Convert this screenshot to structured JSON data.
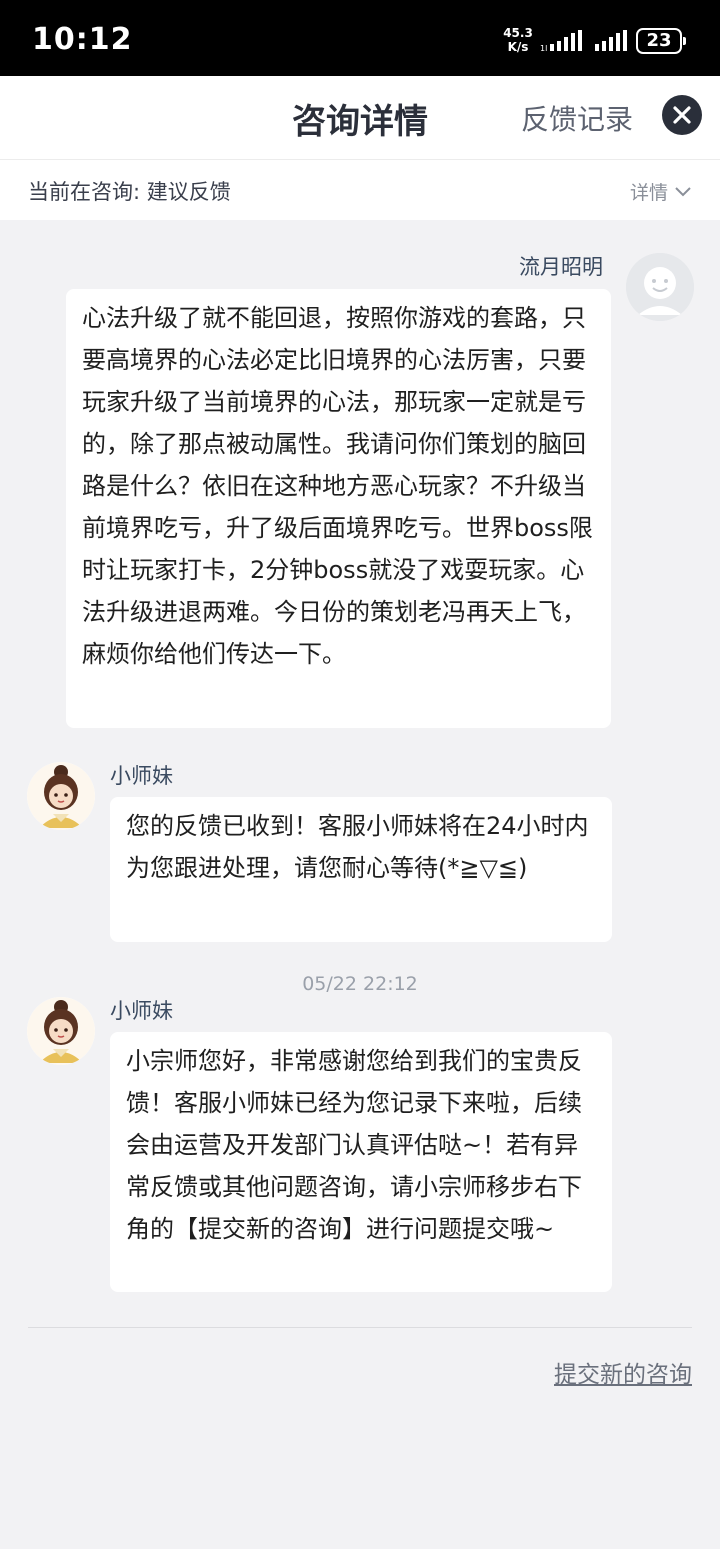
{
  "status_bar": {
    "time": "10:12",
    "net_speed_value": "45.3",
    "net_speed_unit": "K/s",
    "battery": "23"
  },
  "header": {
    "title": "咨询详情",
    "record_label": "反馈记录"
  },
  "consult": {
    "label": "当前在咨询:  建议反馈",
    "detail_label": "详情"
  },
  "messages": [
    {
      "sender": "流月昭明",
      "text": "心法升级了就不能回退，按照你游戏的套路，只要高境界的心法必定比旧境界的心法厉害，只要玩家升级了当前境界的心法，那玩家一定就是亏的，除了那点被动属性。我请问你们策划的脑回路是什么？依旧在这种地方恶心玩家？不升级当前境界吃亏，升了级后面境界吃亏。世界boss限时让玩家打卡，2分钟boss就没了戏耍玩家。心法升级进退两难。今日份的策划老冯再天上飞，麻烦你给他们传达一下。"
    },
    {
      "sender": "小师妹",
      "text": "您的反馈已收到！客服小师妹将在24小时内为您跟进处理，请您耐心等待(*≧▽≦)"
    },
    {
      "timestamp": "05/22 22:12",
      "sender": "小师妹",
      "text": "小宗师您好，非常感谢您给到我们的宝贵反馈！客服小师妹已经为您记录下来啦，后续会由运营及开发部门认真评估哒~！若有异常反馈或其他问题咨询，请小宗师移步右下角的【提交新的咨询】进行问题提交哦~"
    }
  ],
  "footer": {
    "submit_label": "提交新的咨询"
  },
  "colors": {
    "status_bar_bg": "#000000",
    "page_bg": "#f2f2f4",
    "bubble_bg": "#ffffff",
    "close_button": "#2a2f3a"
  },
  "icons": [
    "signal-icon",
    "battery-icon",
    "close-icon",
    "chevron-down-icon",
    "user-avatar-icon",
    "agent-avatar-icon"
  ]
}
